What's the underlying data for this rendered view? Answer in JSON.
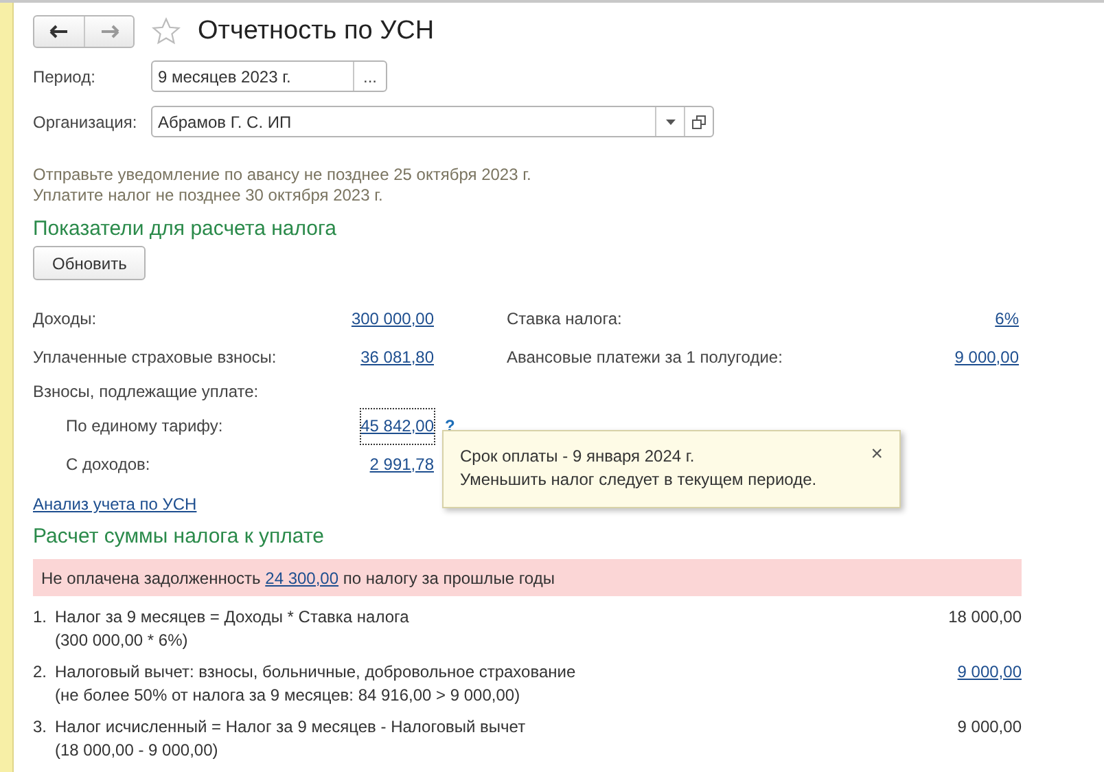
{
  "header": {
    "title": "Отчетность по УСН",
    "favorite": false
  },
  "period": {
    "label": "Период:",
    "value": "9 месяцев 2023 г.",
    "select_button": "..."
  },
  "organization": {
    "label": "Организация:",
    "value": "Абрамов Г. С. ИП"
  },
  "notices": [
    "Отправьте уведомление по авансу не позднее 25 октября 2023 г.",
    "Уплатите налог не позднее 30 октября 2023 г."
  ],
  "indicators": {
    "heading": "Показатели для расчета налога",
    "refresh_button": "Обновить",
    "left": [
      {
        "label": "Доходы:",
        "value": "300 000,00"
      },
      {
        "label": "Уплаченные страховые взносы:",
        "value": "36 081,80"
      }
    ],
    "right": [
      {
        "label": "Ставка налога:",
        "value": "6%"
      },
      {
        "label": "Авансовые платежи за 1 полугодие:",
        "value": "9 000,00"
      }
    ],
    "contributions_label": "Взносы, подлежащие уплате:",
    "contributions": [
      {
        "label": "По единому тарифу:",
        "value": "45 842,00",
        "focused": true,
        "help": "?"
      },
      {
        "label": "С доходов:",
        "value": "2 991,78",
        "focused": false
      }
    ],
    "analysis_link": "Анализ учета по УСН"
  },
  "tooltip": {
    "lines": [
      "Срок оплаты - 9 января 2024 г.",
      "Уменьшить налог следует в текущем периоде."
    ],
    "close": "×"
  },
  "calculation": {
    "heading": "Расчет суммы налога к уплате",
    "debt": {
      "before": "Не оплачена задолженность",
      "amount": "24 300,00",
      "after": "по налогу за прошлые годы"
    },
    "items": [
      {
        "number": "1.",
        "title": "Налог за 9 месяцев = Доходы * Ставка налога",
        "detail": "(300 000,00 * 6%)",
        "amount": "18 000,00",
        "kind": "plain"
      },
      {
        "number": "2.",
        "title": "Налоговый вычет: взносы, больничные, добровольное страхование",
        "detail": "(не более 50% от налога за 9 месяцев: 84 916,00 > 9 000,00)",
        "amount": "9 000,00",
        "kind": "link"
      },
      {
        "number": "3.",
        "title": "Налог исчисленный = Налог за 9 месяцев - Налоговый вычет",
        "detail": "(18 000,00 - 9 000,00)",
        "amount": "9 000,00",
        "kind": "plain"
      }
    ]
  }
}
